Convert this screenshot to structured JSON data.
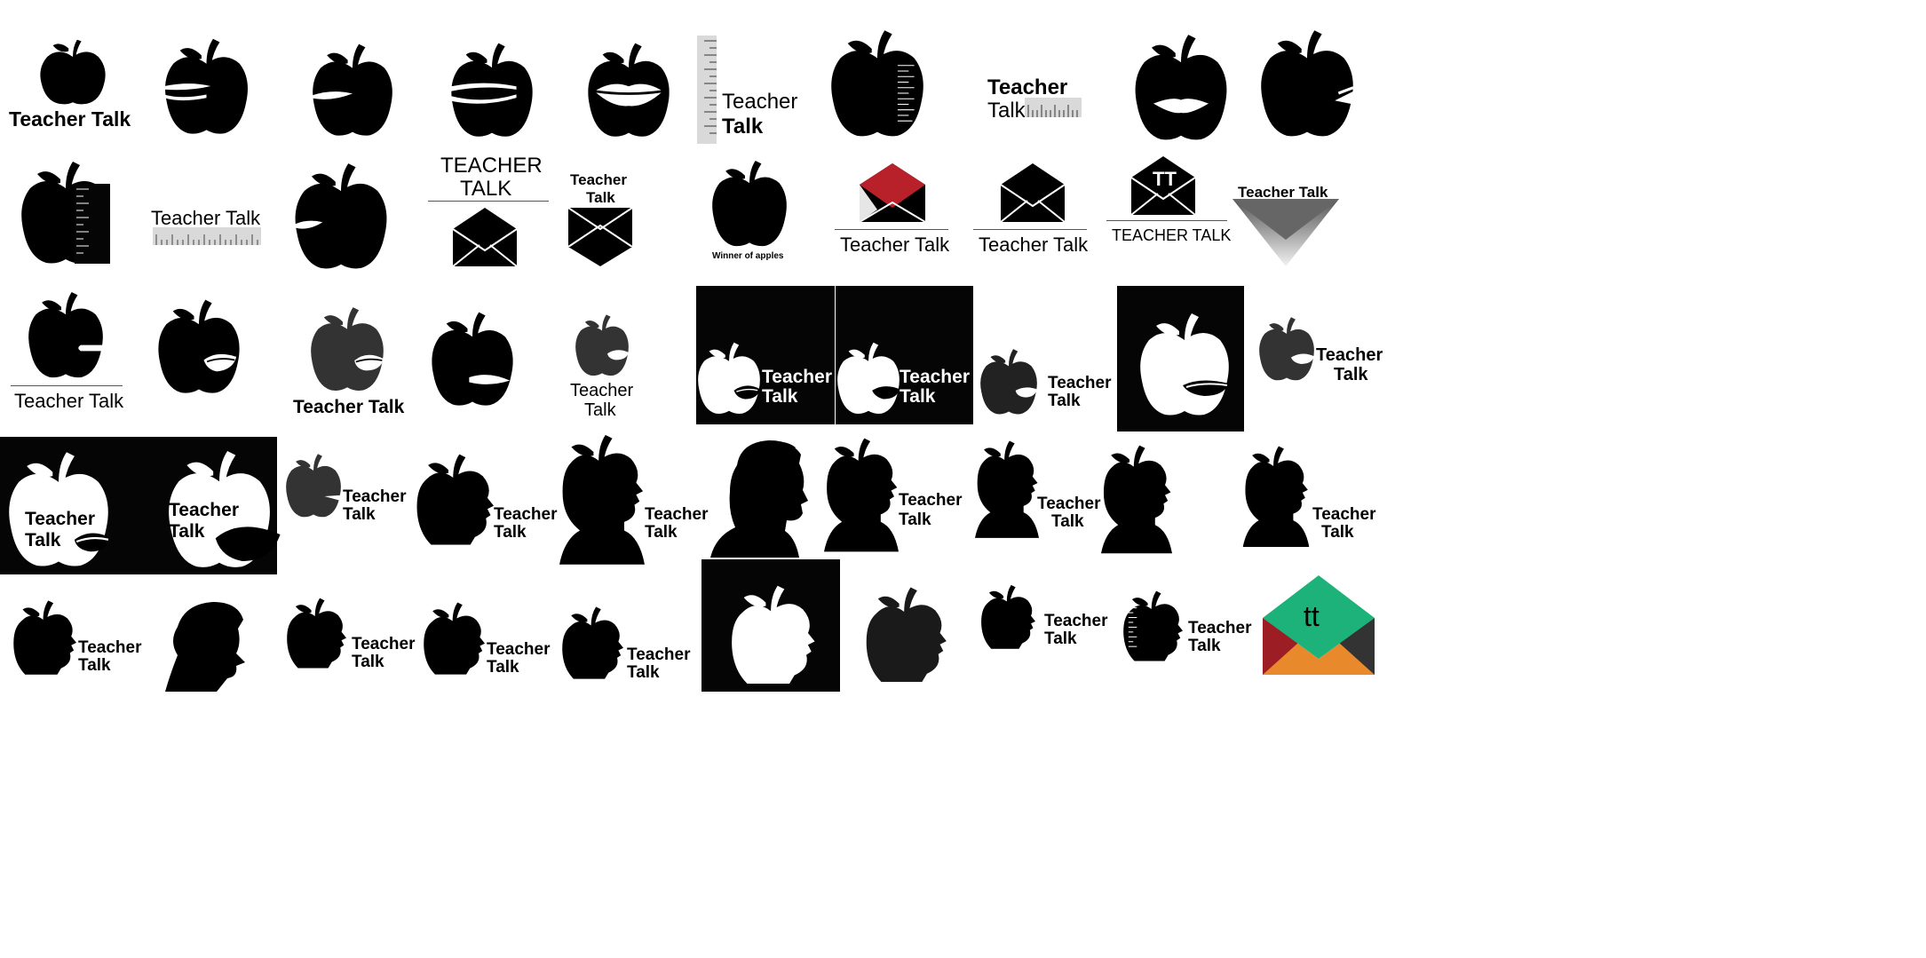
{
  "brand": {
    "line1": "Teacher",
    "line2": "Talk",
    "full": "Teacher Talk",
    "caps_line1": "TEACHER",
    "caps_line2": "TALK",
    "caps_full": "TEACHER TALK",
    "monogram_caps": "TT",
    "monogram_lower": "tt",
    "slogan": "Winner of apples"
  },
  "colors": {
    "black": "#000000",
    "white": "#ffffff",
    "red": "#b8202a",
    "green": "#1db27a",
    "orange": "#e88a2c",
    "maroon": "#9c1e24",
    "charcoal": "#333333",
    "ruler_grey": "#d9d9d9"
  },
  "icons": [
    "apple-icon",
    "apple-mouth-icon",
    "lips-icon",
    "ruler-icon",
    "envelope-icon",
    "head-silhouette-icon",
    "apple-head-icon"
  ]
}
